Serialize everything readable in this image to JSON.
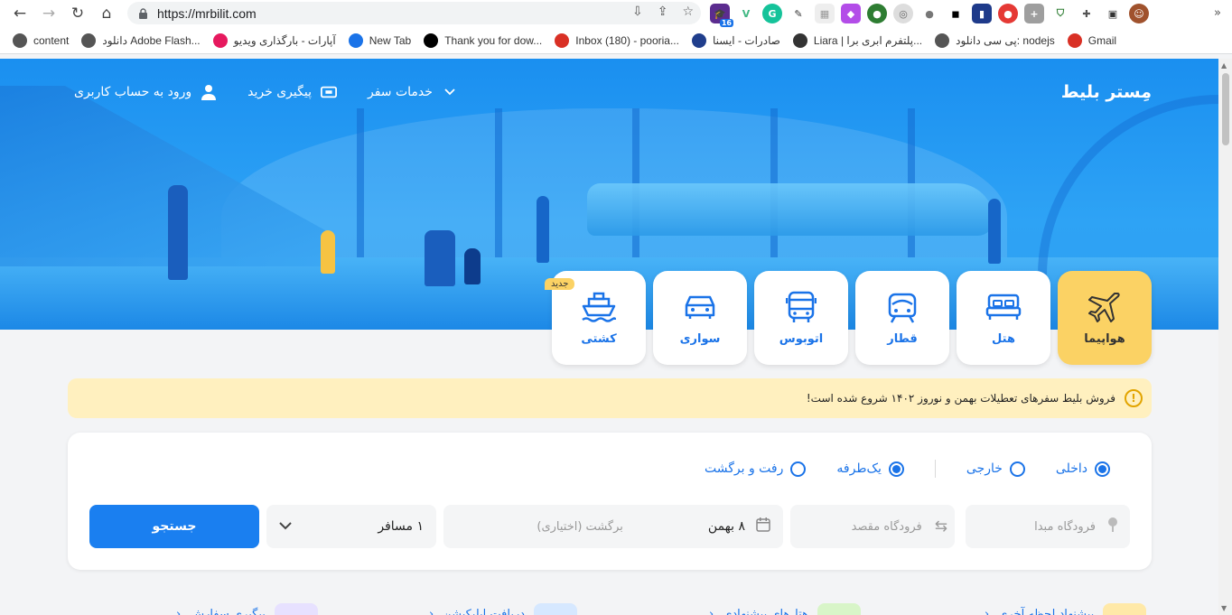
{
  "browser": {
    "url": "https://mrbilit.com",
    "bookmarks": [
      {
        "label": "content",
        "color": "#555"
      },
      {
        "label": "دانلود Adobe Flash...",
        "color": "#555"
      },
      {
        "label": "آپارات - بارگذاری ویدیو",
        "color": "#e6195e"
      },
      {
        "label": "New Tab",
        "color": "#1a73e8"
      },
      {
        "label": "Thank you for dow...",
        "color": "#000"
      },
      {
        "label": "Inbox (180) - pooria...",
        "color": "#d93025"
      },
      {
        "label": "صادرات - ایسنا",
        "color": "#203e8c"
      },
      {
        "label": "Liara | پلتفرم ابری برا...",
        "color": "#333"
      },
      {
        "label": "پی سی دانلود: nodejs",
        "color": "#555"
      },
      {
        "label": "Gmail",
        "color": "#d93025"
      }
    ],
    "extension_badge": "16"
  },
  "header": {
    "logo": "مِستر بلیط",
    "nav": {
      "login": "ورود به حساب کاربری",
      "track": "پیگیری خرید",
      "services": "خدمات سفر"
    }
  },
  "services": [
    {
      "label": "هواپیما",
      "icon": "airplane-icon",
      "active": true
    },
    {
      "label": "هتل",
      "icon": "bed-icon",
      "active": false
    },
    {
      "label": "قطار",
      "icon": "train-icon",
      "active": false
    },
    {
      "label": "اتوبوس",
      "icon": "bus-icon",
      "active": false
    },
    {
      "label": "سواری",
      "icon": "car-icon",
      "active": false
    },
    {
      "label": "کشتی",
      "icon": "ship-icon",
      "active": false,
      "badge": "جدید"
    }
  ],
  "notice": {
    "text": "فروش بلیط سفرهای تعطیلات بهمن و نوروز ۱۴۰۲ شروع شده است!"
  },
  "search": {
    "radios": {
      "domestic": "داخلی",
      "foreign": "خارجی",
      "oneway": "یک‌طرفه",
      "roundtrip": "رفت و برگشت"
    },
    "origin_placeholder": "فرودگاه مبدا",
    "destination_placeholder": "فرودگاه مقصد",
    "date_value": "۸ بهمن",
    "return_placeholder": "برگشت (اختیاری)",
    "passengers": "۱ مسافر",
    "button": "جستجو"
  },
  "promos": [
    "پیشنهاد لحظه آخری",
    "هتل‌های پیشنهادی",
    "دریافت اپلیکیشن",
    "پیگیری سفارش"
  ],
  "colors": {
    "primary": "#1a7ff0",
    "accent": "#fbd264",
    "notice_bg": "#fff0bf"
  }
}
